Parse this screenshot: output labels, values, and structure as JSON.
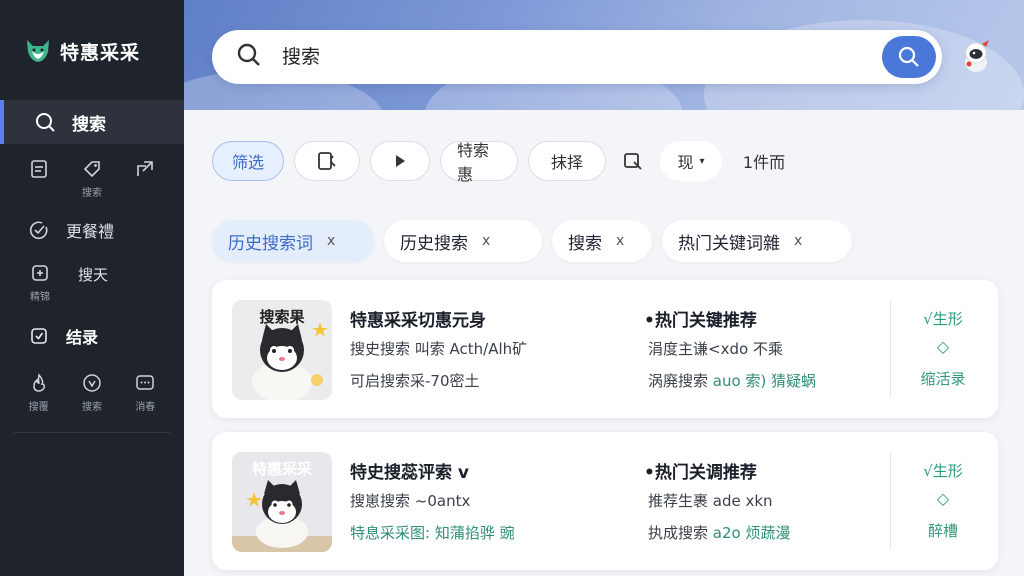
{
  "app": {
    "name": "特惠采采"
  },
  "sidebar": {
    "active": {
      "label": "搜索",
      "icon": "search-icon"
    },
    "row1": [
      {
        "icon": "note-icon",
        "caption": ""
      },
      {
        "icon": "tag-icon",
        "caption": "搜索"
      },
      {
        "icon": "share-icon",
        "caption": ""
      }
    ],
    "more": {
      "label": "更餐禮",
      "icon": "check-circle-icon"
    },
    "row2": [
      {
        "icon": "grid-icon",
        "caption": "精锦",
        "label": "搜天"
      }
    ],
    "results": {
      "label": "结录",
      "icon": "shield-check-icon"
    },
    "row3": [
      {
        "icon": "flame-icon",
        "caption": "搜覆"
      },
      {
        "icon": "star-circle-icon",
        "caption": "搜索"
      },
      {
        "icon": "chat-icon",
        "caption": "消春"
      }
    ]
  },
  "search": {
    "placeholder": "搜索",
    "button_icon": "search-icon"
  },
  "filters": [
    {
      "label": "筛选",
      "primary": true
    },
    {
      "label": "",
      "icon": "scan-icon"
    },
    {
      "label": "",
      "icon": "play-icon"
    },
    {
      "label": "特索惠"
    },
    {
      "label": "抹择"
    },
    {
      "label": "",
      "icon": "crop-icon",
      "bare": true
    },
    {
      "label": "现",
      "suffix": "▾"
    },
    {
      "label": "1件而",
      "bare": true
    }
  ],
  "history": [
    {
      "label": "历史搜索词",
      "close": "x",
      "primary": true
    },
    {
      "label": "历史搜索",
      "close": "x"
    },
    {
      "label": "搜索",
      "close": "x"
    },
    {
      "label": "热门关键词雜",
      "close": "x"
    }
  ],
  "results": [
    {
      "thumb_title": "搜索果",
      "title": "特惠采采切惠元身",
      "line1": "搜史搜索 叫索 Acth/Alh矿",
      "line2": "可启搜索采-70密土",
      "mid_title": "•热门关键推荐",
      "mid_line1": "涓度主谦<xdo 不乘",
      "mid_line2_a": "涡廃搜索",
      "mid_line2_b": "auo 索) 猜疑蜗",
      "act_top": "√生形",
      "act_mid": "◇",
      "act_bottom": "缩活录"
    },
    {
      "thumb_title": "特惠采采",
      "title": "特史搜蕊评索 v",
      "line1": "搜崽搜索 ~0antx",
      "line2": "特息采采图: 知蒲掐骅 豌",
      "mid_title": "•热门关调推荐",
      "mid_line1": "推荐生裹 ade xkn",
      "mid_line2_a": "执成搜索",
      "mid_line2_b": "a2o 烦蔬漫",
      "act_top": "√生形",
      "act_mid": "◇",
      "act_bottom": "醉槽"
    }
  ],
  "colors": {
    "sidebar_bg": "#1f232c",
    "accent": "#4a78d8",
    "green": "#2f8e76"
  }
}
